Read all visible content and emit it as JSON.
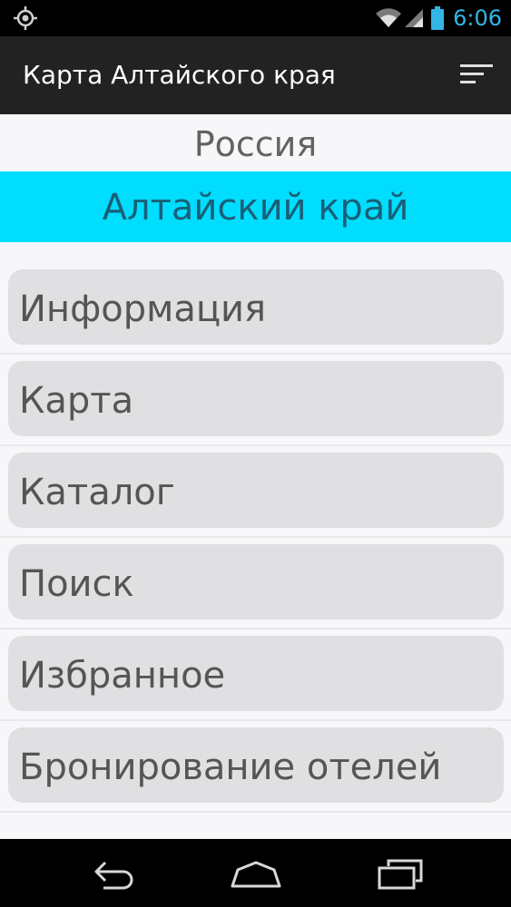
{
  "status_bar": {
    "time": "6:06",
    "icons": [
      "location-icon",
      "wifi-icon",
      "signal-icon",
      "battery-icon"
    ],
    "time_color": "#33b5e5"
  },
  "action_bar": {
    "title": "Карта Алтайского края",
    "menu_icon": "sort-menu-icon"
  },
  "header": {
    "country": "Россия",
    "region": "Алтайский край",
    "region_background": "#00ddff"
  },
  "menu": {
    "items": [
      {
        "label": "Информация"
      },
      {
        "label": "Карта"
      },
      {
        "label": "Каталог"
      },
      {
        "label": "Поиск"
      },
      {
        "label": "Избранное"
      },
      {
        "label": "Бронирование отелей"
      }
    ]
  },
  "nav_bar": {
    "icons": [
      "back-icon",
      "home-icon",
      "recent-apps-icon"
    ]
  }
}
